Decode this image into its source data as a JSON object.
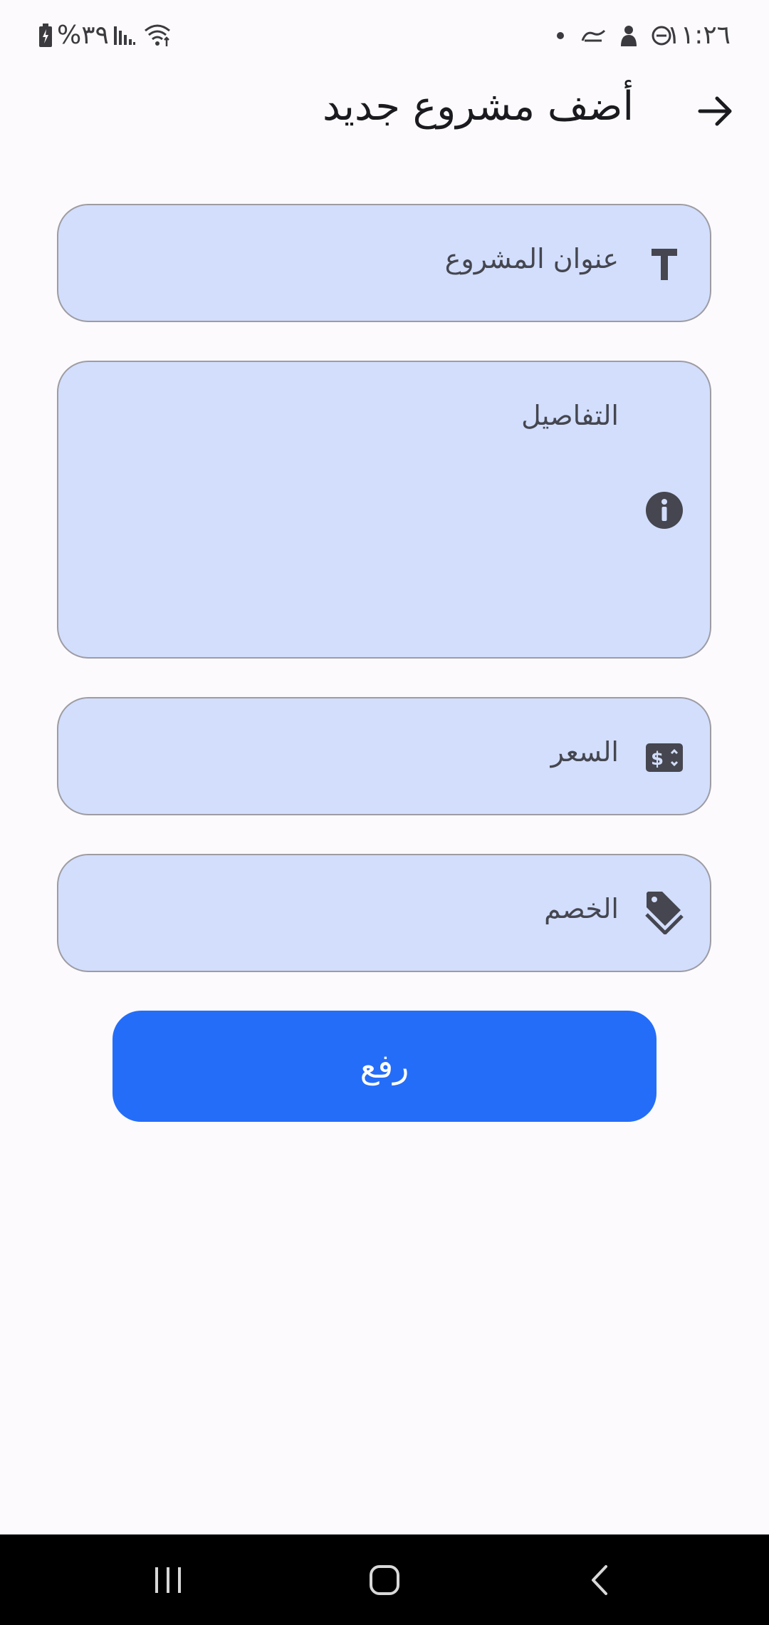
{
  "status_bar": {
    "time": "١١:٢٦",
    "battery": "%٣٩"
  },
  "app_bar": {
    "title": "أضف مشروع جديد",
    "back_icon": "arrow-right-icon"
  },
  "form": {
    "fields": [
      {
        "label": "عنوان المشروع",
        "icon": "text-title-icon"
      },
      {
        "label": "التفاصيل",
        "icon": "info-icon"
      },
      {
        "label": "السعر",
        "icon": "money-icon"
      },
      {
        "label": "الخصم",
        "icon": "tag-icon"
      }
    ],
    "submit_label": "رفع"
  },
  "colors": {
    "field_bg": "#d2defc",
    "field_border": "#9e9ca2",
    "primary": "#246df8",
    "background": "#fcfafd"
  }
}
